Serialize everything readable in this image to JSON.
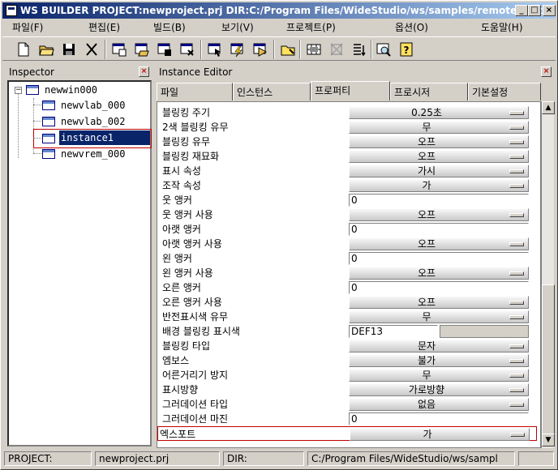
{
  "window": {
    "title": "WS BUILDER PROJECT:newproject.prj DIR:C:/Program Files/WideStudio/ws/samples/remote_instance/...",
    "min": "_",
    "max": "□",
    "close": "×"
  },
  "menubar": [
    {
      "label": "파일(F)"
    },
    {
      "label": "편집(E)"
    },
    {
      "label": "빌드(B)"
    },
    {
      "label": "보기(V)"
    },
    {
      "label": "프로젝트(P)"
    },
    {
      "label": "옵션(O)"
    },
    {
      "label": "도움말(H)"
    }
  ],
  "toolbar": [
    {
      "name": "new-file-icon"
    },
    {
      "name": "open-folder-icon"
    },
    {
      "name": "save-icon"
    },
    {
      "name": "cut-icon"
    },
    {
      "name": "new-window-icon"
    },
    {
      "name": "open-window-icon"
    },
    {
      "name": "save-window-icon"
    },
    {
      "name": "close-window-icon"
    },
    {
      "name": "window-select-icon"
    },
    {
      "name": "build-icon"
    },
    {
      "name": "run-icon"
    },
    {
      "name": "folder-icon"
    },
    {
      "name": "grid-icon"
    },
    {
      "name": "align-icon"
    },
    {
      "name": "list-icon"
    },
    {
      "name": "preview-icon"
    },
    {
      "name": "help-icon"
    }
  ],
  "inspector": {
    "title": "Inspector",
    "close": "×",
    "tree": [
      {
        "label": "newwin000",
        "level": 0
      },
      {
        "label": "newvlab_000",
        "level": 1
      },
      {
        "label": "newvlab_002",
        "level": 1
      },
      {
        "label": "instance1",
        "level": 1,
        "selected": true
      },
      {
        "label": "newvrem_000",
        "level": 1
      }
    ]
  },
  "editor": {
    "title": "Instance Editor",
    "close": "×",
    "tabs": [
      {
        "label": "파일"
      },
      {
        "label": "인스턴스"
      },
      {
        "label": "프로퍼티"
      },
      {
        "label": "프로시저"
      },
      {
        "label": "기본설정"
      }
    ],
    "rows": [
      {
        "label": "블링킹 주기",
        "type": "choice",
        "value": "0.25초"
      },
      {
        "label": "2색 블링킹 유무",
        "type": "choice",
        "value": "무"
      },
      {
        "label": "블링킹 유무",
        "type": "choice",
        "value": "오프"
      },
      {
        "label": "블링킹 재묘화",
        "type": "choice",
        "value": "오프"
      },
      {
        "label": "표시 속성",
        "type": "choice",
        "value": "가시"
      },
      {
        "label": "조작 속성",
        "type": "choice",
        "value": "가"
      },
      {
        "label": "웃 앵커",
        "type": "input",
        "value": "0"
      },
      {
        "label": "웃 앵커 사용",
        "type": "choice",
        "value": "오프"
      },
      {
        "label": "아랫 앵커",
        "type": "input",
        "value": "0"
      },
      {
        "label": "아랫  앵커 사용",
        "type": "choice",
        "value": "오프"
      },
      {
        "label": "왼 앵커",
        "type": "input",
        "value": "0"
      },
      {
        "label": "왼  앵커 사용",
        "type": "choice",
        "value": "오프"
      },
      {
        "label": "오른 앵커",
        "type": "input",
        "value": "0"
      },
      {
        "label": "오른  앵커 사용",
        "type": "choice",
        "value": "오프"
      },
      {
        "label": "반전표시색 유무",
        "type": "choice",
        "value": "무"
      },
      {
        "label": "배경 블링킹 표시색",
        "type": "color",
        "value": "DEF13"
      },
      {
        "label": "블링킹 타입",
        "type": "choice",
        "value": "문자"
      },
      {
        "label": "엠보스",
        "type": "choice",
        "value": "불가"
      },
      {
        "label": "어른거리기 방지",
        "type": "choice",
        "value": "무"
      },
      {
        "label": "표시방향",
        "type": "choice",
        "value": "가로방향"
      },
      {
        "label": "그러데이션 타입",
        "type": "choice",
        "value": "없음"
      },
      {
        "label": "그러데이션 마진",
        "type": "input",
        "value": "0"
      },
      {
        "label": "엑스포트",
        "type": "choice",
        "value": "가",
        "selected": true
      }
    ]
  },
  "status": {
    "project_label": "PROJECT:",
    "project_value": "newproject.prj",
    "dir_label": "DIR:",
    "dir_value": "C:/Program Files/WideStudio/ws/sampl"
  }
}
